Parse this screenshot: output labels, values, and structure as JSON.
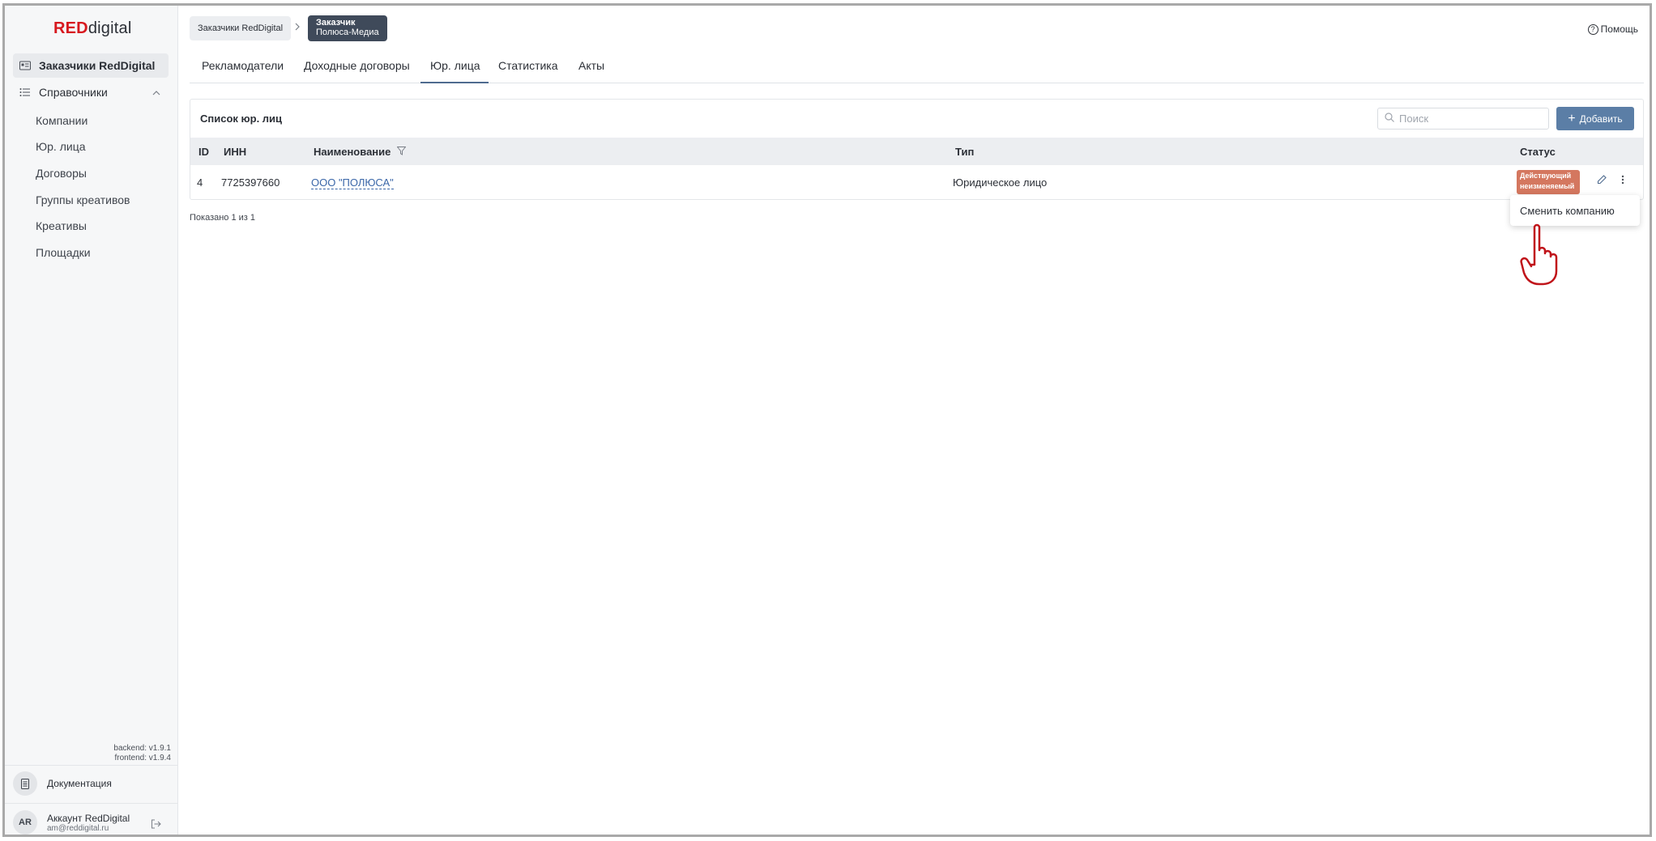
{
  "logo": {
    "red": "RED",
    "rest": "digital"
  },
  "sidebar": {
    "main_item": "Заказчики RedDigital",
    "section": "Справочники",
    "items": [
      "Компании",
      "Юр. лица",
      "Договоры",
      "Группы креативов",
      "Креативы",
      "Площадки"
    ],
    "versions": {
      "backend": "backend: v1.9.1",
      "frontend": "frontend: v1.9.4"
    },
    "docs_label": "Документация",
    "account": {
      "initials": "AR",
      "name": "Аккаунт RedDigital",
      "email": "am@reddigital.ru"
    }
  },
  "breadcrumb": {
    "first": "Заказчики RedDigital",
    "current_title": "Заказчик",
    "current_sub": "Полюса-Медиа"
  },
  "help": "Помощь",
  "tabs": [
    "Рекламодатели",
    "Доходные договоры",
    "Юр. лица",
    "Статистика",
    "Акты"
  ],
  "active_tab": "Юр. лица",
  "list": {
    "title": "Список юр. лиц",
    "search_placeholder": "Поиск",
    "add_label": "Добавить",
    "columns": {
      "id": "ID",
      "inn": "ИНН",
      "name": "Наименование",
      "type": "Тип",
      "status": "Статус"
    },
    "rows": [
      {
        "id": "4",
        "inn": "7725397660",
        "name": "ООО \"ПОЛЮСА\"",
        "type": "Юридическое лицо",
        "status_line1": "Действующий",
        "status_line2": "неизменяемый"
      }
    ],
    "shown": "Показано 1 из 1"
  },
  "dropdown": {
    "item": "Сменить компанию"
  },
  "colors": {
    "accent": "#5b7ea6",
    "badge": "#d4775f",
    "brand_red": "#d7191f"
  }
}
